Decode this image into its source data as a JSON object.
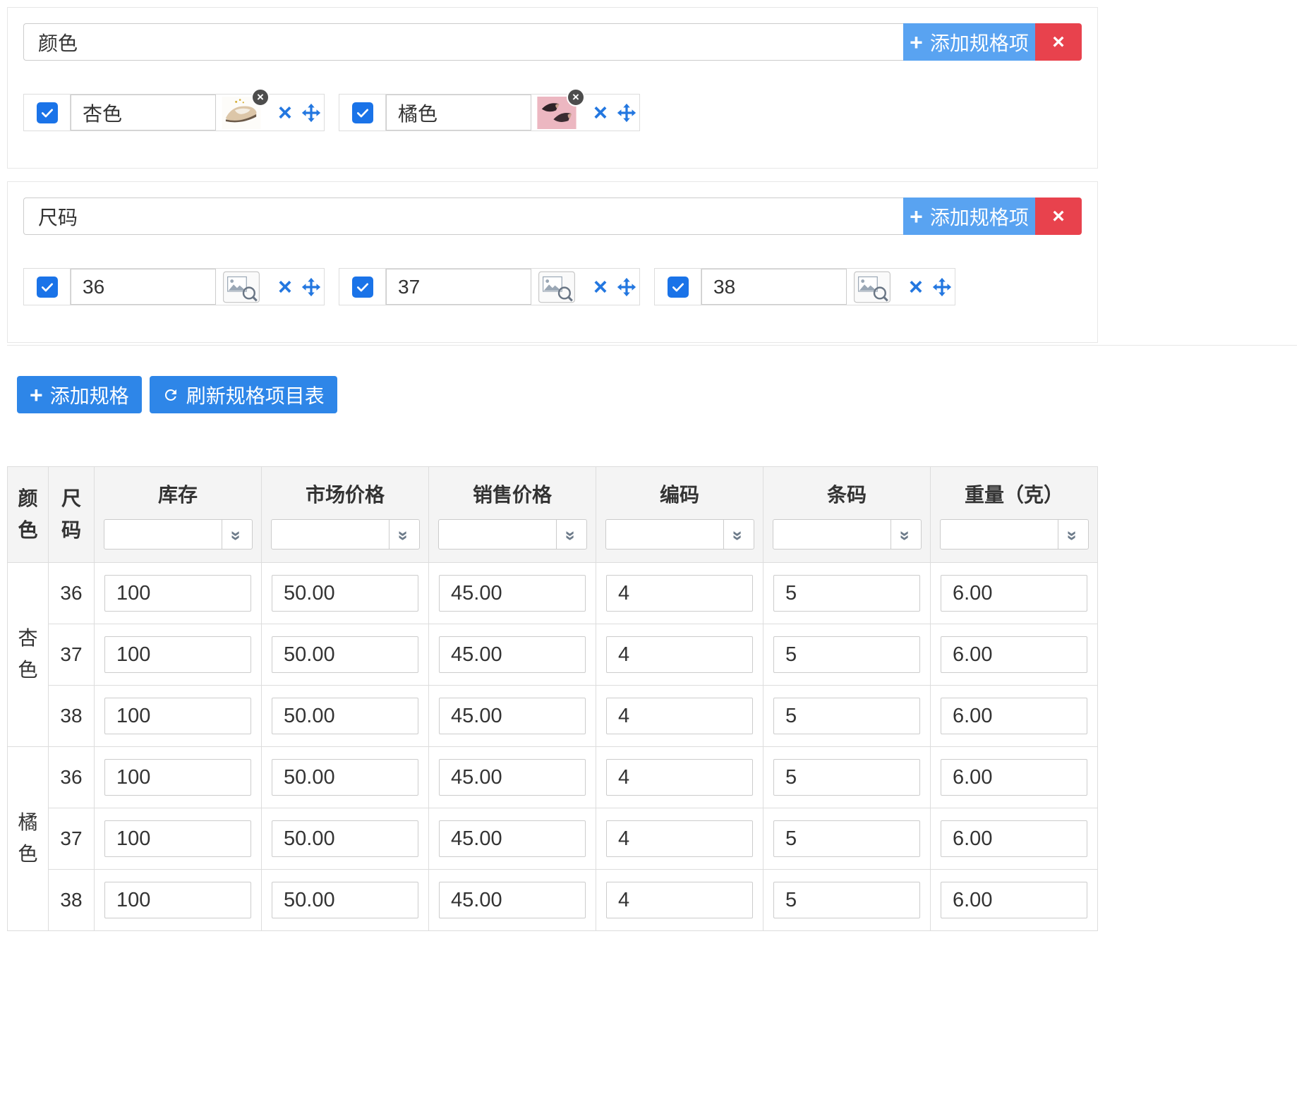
{
  "glyphs": {
    "plus": "+",
    "close": "×",
    "double_chevron": "»"
  },
  "colors": {
    "primary": "#2E86E8",
    "light_blue": "#59A3F1",
    "danger": "#E8424D",
    "checkbox_blue": "#1A73E8",
    "icon_blue": "#2377E0"
  },
  "spec_groups": [
    {
      "name_value": "颜色",
      "add_item_label": "添加规格项",
      "items": [
        {
          "value": "杏色",
          "checked": true,
          "image": "apricot-shoe"
        },
        {
          "value": "橘色",
          "checked": true,
          "image": "orange-shoes"
        }
      ]
    },
    {
      "name_value": "尺码",
      "add_item_label": "添加规格项",
      "items": [
        {
          "value": "36",
          "checked": true,
          "image": null
        },
        {
          "value": "37",
          "checked": true,
          "image": null
        },
        {
          "value": "38",
          "checked": true,
          "image": null
        }
      ]
    }
  ],
  "toolbar": {
    "add_spec_label": "添加规格",
    "refresh_label": "刷新规格项目表"
  },
  "sku_table": {
    "row_headers": {
      "color": "颜色",
      "size": "尺码"
    },
    "columns": [
      "库存",
      "市场价格",
      "销售价格",
      "编码",
      "条码",
      "重量（克）"
    ],
    "groups": [
      {
        "color": "杏色",
        "rows": [
          {
            "size": "36",
            "values": [
              "100",
              "50.00",
              "45.00",
              "4",
              "5",
              "6.00"
            ]
          },
          {
            "size": "37",
            "values": [
              "100",
              "50.00",
              "45.00",
              "4",
              "5",
              "6.00"
            ]
          },
          {
            "size": "38",
            "values": [
              "100",
              "50.00",
              "45.00",
              "4",
              "5",
              "6.00"
            ]
          }
        ]
      },
      {
        "color": "橘色",
        "rows": [
          {
            "size": "36",
            "values": [
              "100",
              "50.00",
              "45.00",
              "4",
              "5",
              "6.00"
            ]
          },
          {
            "size": "37",
            "values": [
              "100",
              "50.00",
              "45.00",
              "4",
              "5",
              "6.00"
            ]
          },
          {
            "size": "38",
            "values": [
              "100",
              "50.00",
              "45.00",
              "4",
              "5",
              "6.00"
            ]
          }
        ]
      }
    ]
  }
}
